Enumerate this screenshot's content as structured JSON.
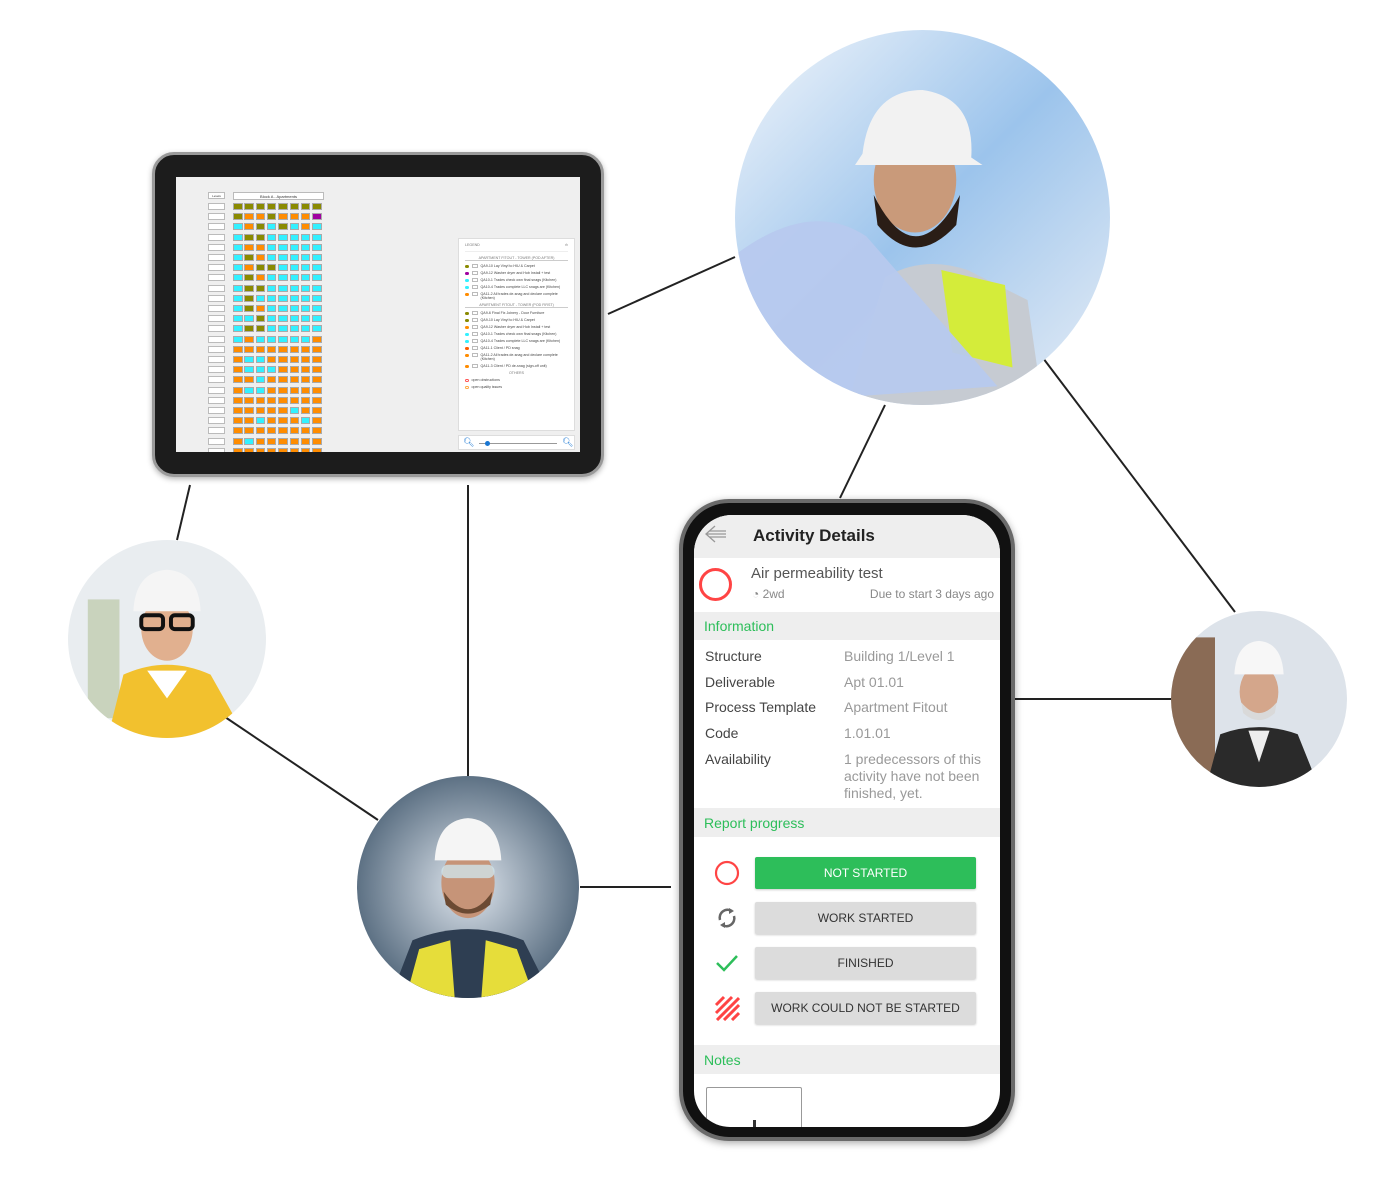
{
  "tablet": {
    "grid_title": "Block A - Apartments",
    "level_header": "Levels",
    "cell_colors": {
      "g": "#8a8a00",
      "o": "#ff8c00",
      "c": "#33f0ff",
      "p": "#a000a0"
    },
    "grid_rows": [
      "gggggggg",
      "googooop",
      "cogcgcoc",
      "cggccccc",
      "cooccccc",
      "cgoccccc",
      "coggcccc",
      "cgoccccc",
      "cggccccc",
      "cgcccccc",
      "cgoccccc",
      "ccgccccc",
      "cggccccc",
      "coccccco",
      "oooooooo",
      "occooooo",
      "occcoooo",
      "oocooooo",
      "occooooo",
      "oooooooo",
      "ooooocoo",
      "oocoooco",
      "oooooooo",
      "ocoooooo",
      "oooooooo",
      "oooo"
    ],
    "legend": {
      "title": "LEGEND",
      "sections": [
        {
          "title": "APARTMENT FITOUT - TOWER (POD AFTER)",
          "items": [
            {
              "label": "QA9-10 Lay Vinyl to HIU & Carpet",
              "color": "#8a8a00"
            },
            {
              "label": "QA9-12 Washer dryer and Hob Install + test",
              "color": "#a000a0"
            },
            {
              "label": "QA10-1 Trades check own final snags (Kitchen)",
              "color": "#33f0ff"
            },
            {
              "label": "QA10-4 Trades complete LLC snags are (Kitchen)",
              "color": "#33f0ff"
            },
            {
              "label": "QA11-2 All trades de-snag and declare complete (Kitchen)",
              "color": "#ff8c00"
            }
          ]
        },
        {
          "title": "APARTMENT FITOUT - TOWER (POD FIRST)",
          "items": [
            {
              "label": "QA9-6 Final Fix Joinery - Door Furniture",
              "color": "#8a8a00"
            },
            {
              "label": "QA9-10 Lay Vinyl to HIU & Carpet",
              "color": "#8a8a00"
            },
            {
              "label": "QA9-12 Washer dryer and Hob Install + test",
              "color": "#ff8c00"
            },
            {
              "label": "QA10-1 Trades check own final snags (Kitchen)",
              "color": "#33f0ff"
            },
            {
              "label": "QA10-4 Trades complete LLC snags are (Kitchen)",
              "color": "#33f0ff"
            },
            {
              "label": "QA11-1 Client / PD snag",
              "color": "#ff5a00"
            },
            {
              "label": "QA11-2 All trades de-snag and declare complete (Kitchen)",
              "color": "#ff8c00"
            },
            {
              "label": "QA11-3 Client / PD de-snag (sign-off unit)",
              "color": "#ff8c00"
            }
          ]
        }
      ],
      "others_title": "OTHERS",
      "others": [
        {
          "label": "open obstructions",
          "color": "#ff5555"
        },
        {
          "label": "open quality issues",
          "color": "#ffaa44"
        }
      ]
    },
    "zoom_level": 0.1
  },
  "phone": {
    "title": "Activity Details",
    "activity": {
      "name": "Air permeability test",
      "duration": "2wd",
      "due": "Due to start 3 days ago"
    },
    "information_header": "Information",
    "info": [
      {
        "label": "Structure",
        "value": "Building 1/Level 1"
      },
      {
        "label": "Deliverable",
        "value": "Apt 01.01"
      },
      {
        "label": "Process Template",
        "value": "Apartment Fitout"
      },
      {
        "label": "Code",
        "value": "1.01.01"
      },
      {
        "label": "Availability",
        "value": "1 predecessors of this activity have not been finished, yet."
      }
    ],
    "report_header": "Report progress",
    "statuses": [
      {
        "label": "NOT STARTED",
        "icon": "circle-icon",
        "selected": true
      },
      {
        "label": "WORK STARTED",
        "icon": "refresh-icon",
        "selected": false
      },
      {
        "label": "FINISHED",
        "icon": "check-icon",
        "selected": false
      },
      {
        "label": "WORK COULD NOT BE STARTED",
        "icon": "hatched-icon",
        "selected": false
      }
    ],
    "notes_header": "Notes"
  },
  "colors": {
    "accent_green": "#2dbe5a",
    "status_red": "#ff4444"
  }
}
